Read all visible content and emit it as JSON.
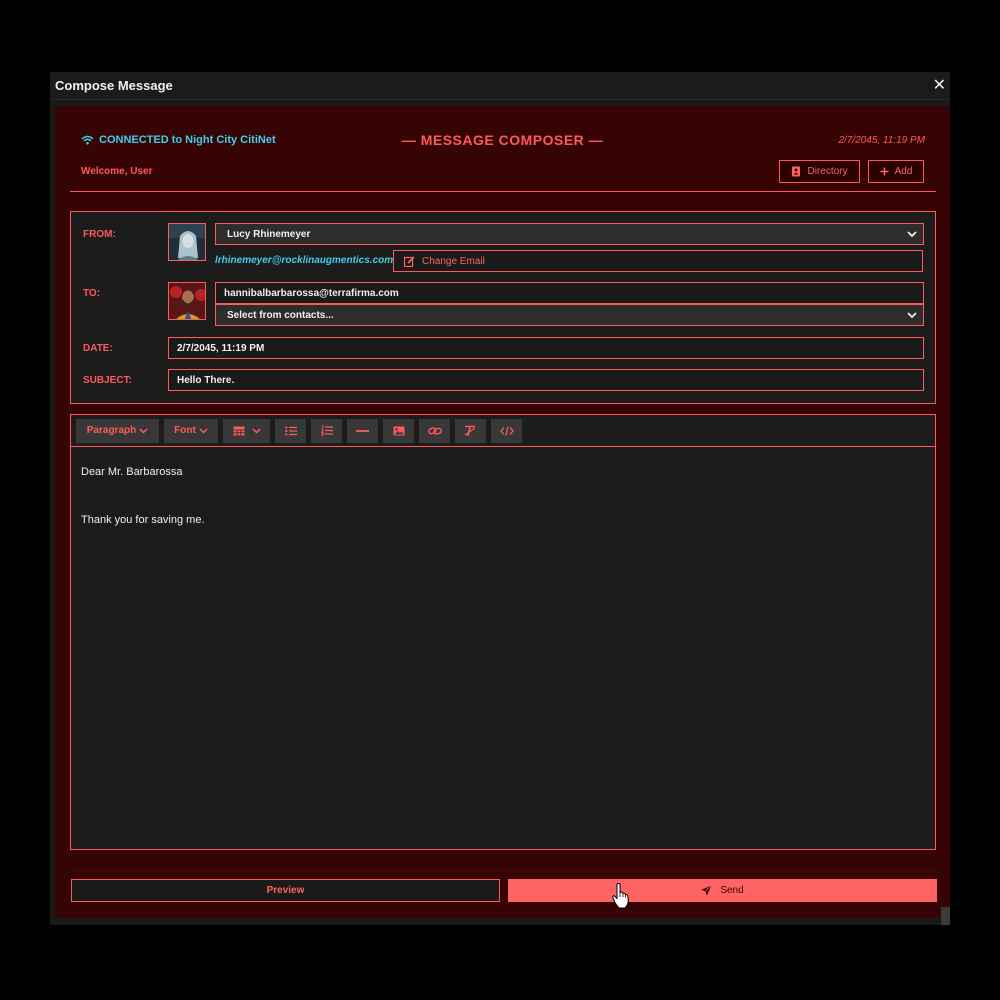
{
  "window": {
    "title": "Compose Message",
    "close_glyph": "✕"
  },
  "header": {
    "connection": "CONNECTED to Night City CitiNet",
    "title": "— MESSAGE COMPOSER —",
    "datetime": "2/7/2045, 11:19 PM",
    "welcome": "Welcome, User",
    "directory_label": "Directory",
    "add_label": "Add"
  },
  "form": {
    "from_label": "FROM:",
    "from_name": "Lucy Rhinemeyer",
    "from_email": "lrhinemeyer@rocklinaugmentics.com",
    "change_email_label": "Change Email",
    "to_label": "TO:",
    "to_value": "hannibalbarbarossa@terrafirma.com",
    "contacts_placeholder": "Select from contacts...",
    "date_label": "DATE:",
    "date_value": "2/7/2045, 11:19 PM",
    "subject_label": "SUBJECT:",
    "subject_value": "Hello There."
  },
  "toolbar": {
    "paragraph_label": "Paragraph",
    "font_label": "Font"
  },
  "body": {
    "line1": "Dear Mr. Barbarossa",
    "line2": "Thank you for saving me."
  },
  "actions": {
    "preview_label": "Preview",
    "send_label": "Send"
  },
  "colors": {
    "accent": "#ff5a5a",
    "cyan": "#3fd0e8",
    "panel": "#360404",
    "send_bg": "#ff6464"
  }
}
